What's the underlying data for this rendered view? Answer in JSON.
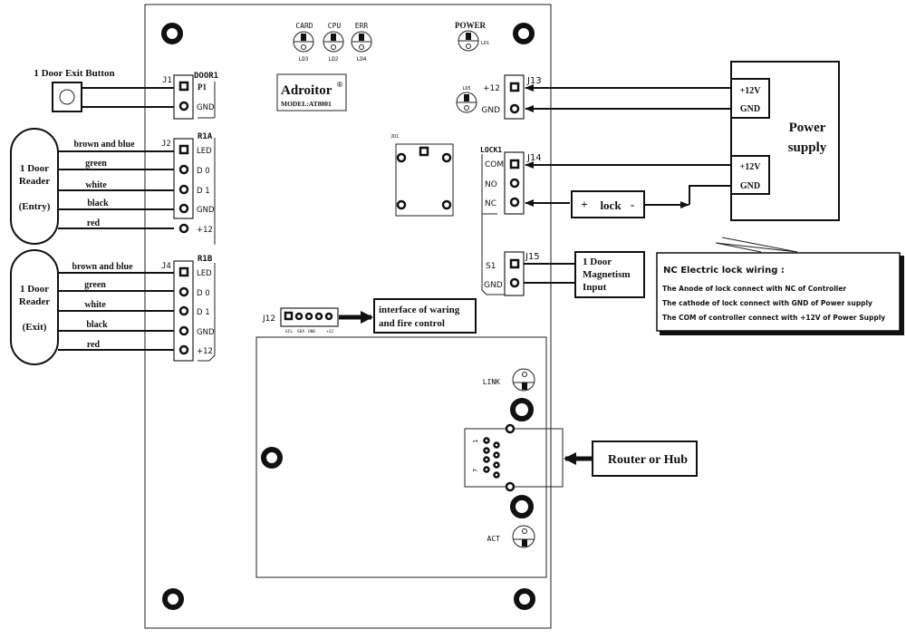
{
  "controller": {
    "brand": "Adroitor",
    "registered_mark": "®",
    "model": "MODEL:AT8001",
    "leds_top": [
      {
        "label": "CARD",
        "ref": "LD3"
      },
      {
        "label": "CPU",
        "ref": "LD2"
      },
      {
        "label": "ERR",
        "ref": "LD4"
      }
    ],
    "power_led": {
      "label": "POWER",
      "ref": "LD1"
    },
    "power_in_led": {
      "ref": "LD5"
    },
    "relay_ref": "JD1",
    "network_leds": {
      "link": "LINK",
      "act": "ACT"
    },
    "rj45_pin_labels": {
      "first": "1",
      "last": "7"
    }
  },
  "connectors": {
    "j1": {
      "ref": "J1",
      "group": "DOOR1",
      "pins": [
        "P1",
        "GND"
      ]
    },
    "j2": {
      "ref": "J2",
      "group": "R1A",
      "pins": [
        "LED",
        "D 0",
        "D 1",
        "GND",
        "+12"
      ]
    },
    "j4": {
      "ref": "J4",
      "group": "R1B",
      "pins": [
        "LED",
        "D 0",
        "D 1",
        "GND",
        "+12"
      ]
    },
    "j13": {
      "ref": "J13",
      "pins": [
        "+12",
        "GND"
      ]
    },
    "j14": {
      "ref": "J14",
      "group": "LOCK1",
      "pins": [
        "COM",
        "NO",
        "NC"
      ]
    },
    "j15": {
      "ref": "J15",
      "pins": [
        "S1",
        "GND"
      ]
    },
    "j12": {
      "ref": "J12",
      "pins": [
        "SCL",
        "SDA",
        "GND",
        "+12"
      ]
    }
  },
  "external": {
    "exit_button": {
      "label": "1 Door Exit Button"
    },
    "reader_entry": {
      "line1": "1 Door",
      "line2": "Reader",
      "line3": "(Entry)"
    },
    "reader_exit": {
      "line1": "1 Door",
      "line2": "Reader",
      "line3": "(Exit)"
    },
    "wire_colors": [
      "brown and blue",
      "green",
      "white",
      "black",
      "red"
    ],
    "power_supply": {
      "line1": "Power",
      "line2": "supply",
      "terminals_top": [
        "+12V",
        "GND"
      ],
      "terminals_bottom": [
        "+12V",
        "GND"
      ]
    },
    "lock": {
      "plus": "+",
      "label": "lock",
      "minus": "-"
    },
    "magnet_input": {
      "line1": "1 Door",
      "line2": "Magnetism",
      "line3": "Input"
    },
    "fire_interface": {
      "line1": "interface of waring",
      "line2": "and fire control"
    },
    "router": {
      "label": "Router or Hub"
    }
  },
  "note": {
    "title": "NC Electric lock wiring :",
    "lines": [
      "The Anode of lock connect with NC of Controller",
      "The cathode of lock connect with GND of Power supply",
      "The COM of controller connect with +12V of Power Supply"
    ]
  }
}
